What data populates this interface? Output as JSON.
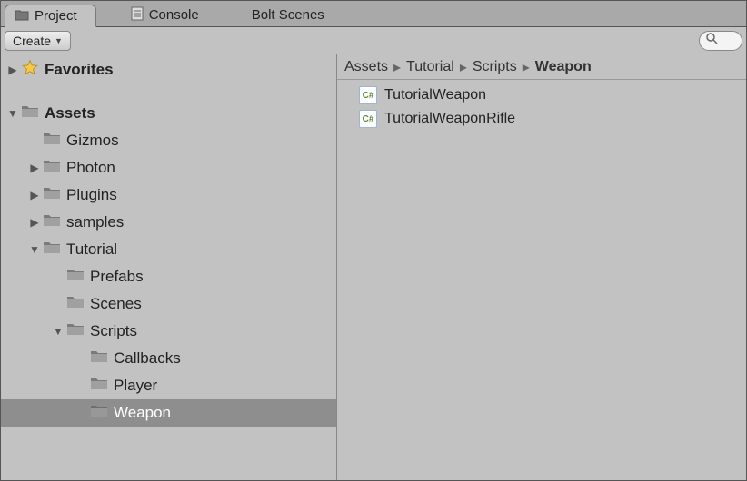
{
  "tabs": {
    "project": "Project",
    "console": "Console",
    "bolt": "Bolt Scenes"
  },
  "toolbar": {
    "create_label": "Create"
  },
  "breadcrumb": {
    "items": [
      "Assets",
      "Tutorial",
      "Scripts",
      "Weapon"
    ]
  },
  "sidebar": {
    "favorites": "Favorites",
    "tree": {
      "assets": "Assets",
      "gizmos": "Gizmos",
      "photon": "Photon",
      "plugins": "Plugins",
      "samples": "samples",
      "tutorial": "Tutorial",
      "prefabs": "Prefabs",
      "scenes": "Scenes",
      "scripts": "Scripts",
      "callbacks": "Callbacks",
      "player": "Player",
      "weapon": "Weapon"
    }
  },
  "files": {
    "items": [
      {
        "name": "TutorialWeapon",
        "type": "cs"
      },
      {
        "name": "TutorialWeaponRifle",
        "type": "cs"
      }
    ]
  },
  "icons": {
    "cs_label": "C#"
  }
}
